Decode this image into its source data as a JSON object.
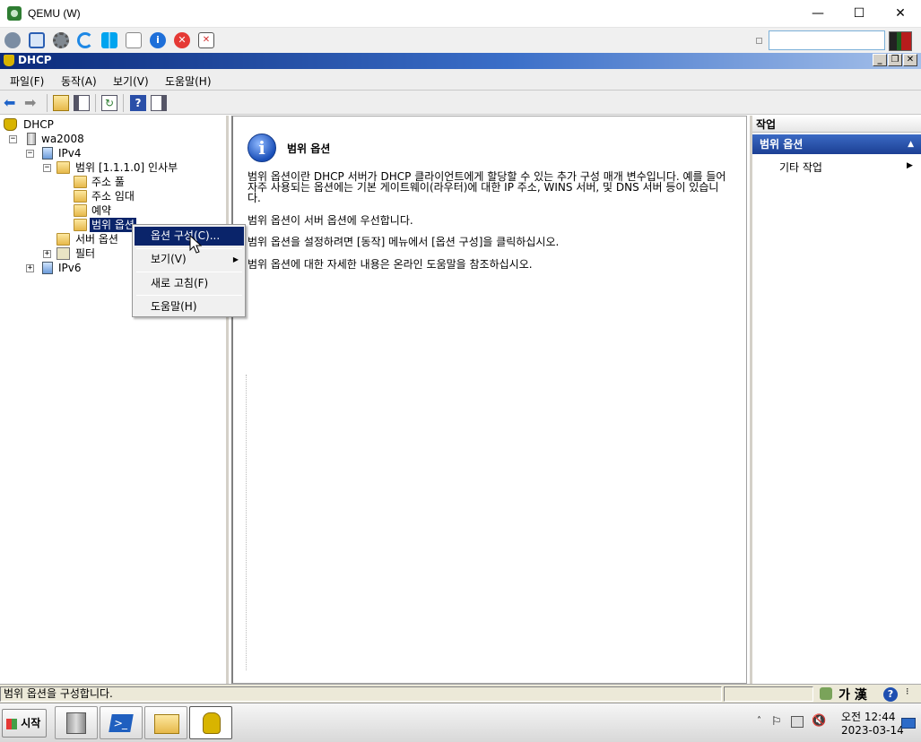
{
  "qemu": {
    "title": "QEMU (W)",
    "controls": {
      "minimize": "—",
      "maximize": "☐",
      "close": "✕"
    },
    "input_value": ""
  },
  "mmc": {
    "title": "DHCP",
    "controls": {
      "minimize": "_",
      "restore": "❐",
      "close": "✕"
    },
    "menu": [
      "파일(F)",
      "동작(A)",
      "보기(V)",
      "도움말(H)"
    ]
  },
  "tree": {
    "root": "DHCP",
    "server": "wa2008",
    "ipv4": "IPv4",
    "scope": "범위 [1.1.1.0] 인사부",
    "address_pool": "주소 풀",
    "address_leases": "주소 임대",
    "reservations": "예약",
    "scope_options": "범위 옵션",
    "server_options": "서버 옵션",
    "filters": "필터",
    "ipv6": "IPv6"
  },
  "context_menu": {
    "items": [
      "옵션 구성(C)...",
      "보기(V)",
      "새로 고침(F)",
      "도움말(H)"
    ]
  },
  "content": {
    "title": "범위 옵션",
    "p1": "범위 옵션이란 DHCP 서버가 DHCP 클라이언트에게 할당할 수 있는 추가 구성 매개 변수입니다. 예를 들어 자주 사용되는 옵션에는 기본 게이트웨이(라우터)에 대한 IP 주소, WINS 서버, 및 DNS 서버 등이 있습니다.",
    "p2": "범위 옵션이 서버 옵션에 우선합니다.",
    "p3": "범위 옵션을 설정하려면 [동작] 메뉴에서 [옵션 구성]을 클릭하십시오.",
    "p4": "범위 옵션에 대한 자세한 내용은 온라인 도움말을 참조하십시오."
  },
  "actions": {
    "header": "작업",
    "section": "범위 옵션",
    "more": "기타 작업"
  },
  "status": {
    "text": "범위 옵션을 구성합니다.",
    "ime": "가 漢"
  },
  "taskbar": {
    "start": "시작",
    "time": "오전 12:44",
    "date": "2023-03-14"
  }
}
